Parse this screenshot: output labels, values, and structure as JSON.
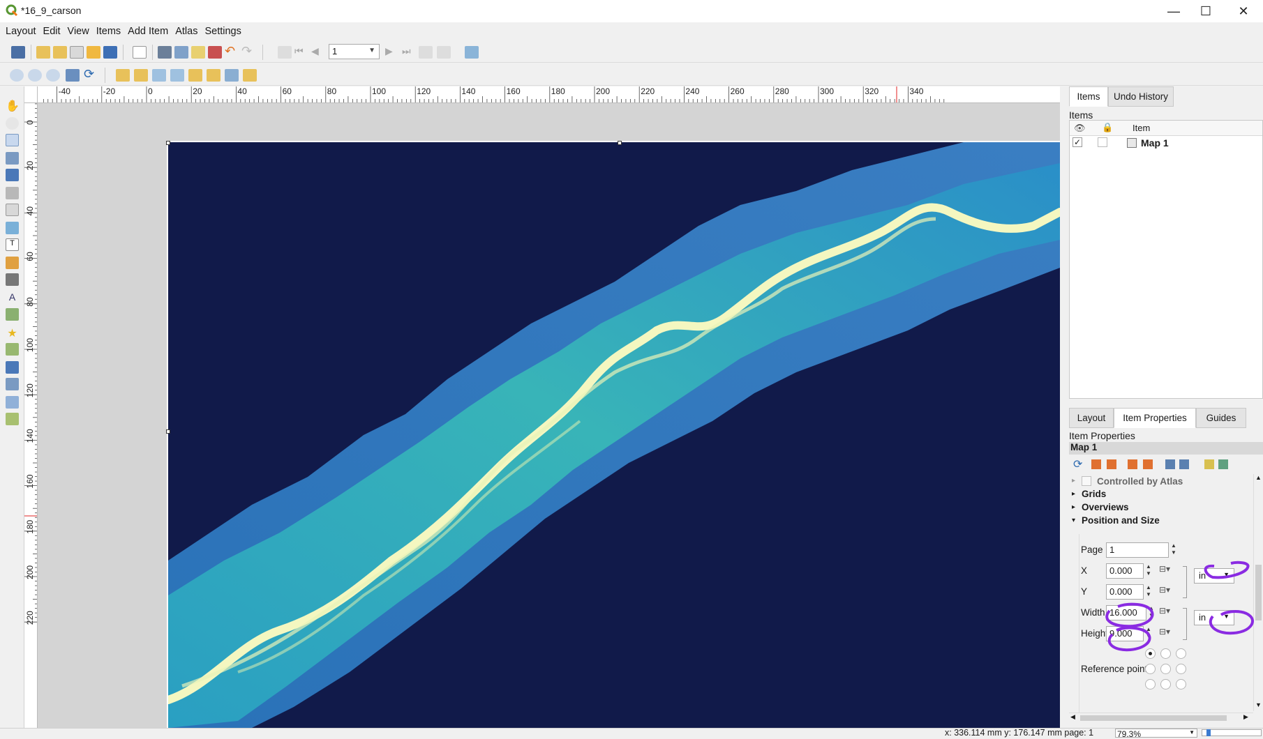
{
  "window": {
    "title": "*16_9_carson",
    "minimize": "—",
    "maximize": "☐",
    "close": "✕"
  },
  "menu": [
    "Layout",
    "Edit",
    "View",
    "Items",
    "Add Item",
    "Atlas",
    "Settings"
  ],
  "toolbar": {
    "page_value": "1"
  },
  "ruler": {
    "top_labels": [
      "-40",
      "-20",
      "0",
      "20",
      "40",
      "60",
      "80",
      "100",
      "120",
      "140",
      "160",
      "180",
      "200",
      "220",
      "240",
      "260",
      "280",
      "300",
      "320",
      "340"
    ],
    "left_labels": [
      "0",
      "20",
      "40",
      "60",
      "80",
      "100",
      "120",
      "140",
      "160",
      "180",
      "200",
      "220"
    ]
  },
  "panel": {
    "tabs_top": [
      "Items",
      "Undo History"
    ],
    "items_title": "Items",
    "items_column": "Item",
    "items": [
      {
        "label": "Map 1",
        "visible": true,
        "locked": false
      }
    ],
    "tabs_bottom": [
      "Layout",
      "Item Properties",
      "Guides"
    ],
    "props_title": "Item Properties",
    "props_item": "Map 1",
    "controlled_by_atlas": "Controlled by Atlas",
    "sections": [
      "Grids",
      "Overviews",
      "Position and Size"
    ],
    "position": {
      "page_label": "Page",
      "page_value": "1",
      "x_label": "X",
      "x_value": "0.000",
      "y_label": "Y",
      "y_value": "0.000",
      "width_label": "Width",
      "width_value": "16.000",
      "height_label": "Height",
      "height_value": "9.000",
      "unit_pos": "in",
      "unit_size": "in",
      "reference_point_label": "Reference point"
    }
  },
  "status": {
    "coords": "x: 336.114 mm y: 176.147 mm page: 1",
    "zoom": "79.3%"
  },
  "colors": {
    "map_bg": "#111a4a",
    "river": "#f4f7c0",
    "annotation": "#8a2be2"
  }
}
